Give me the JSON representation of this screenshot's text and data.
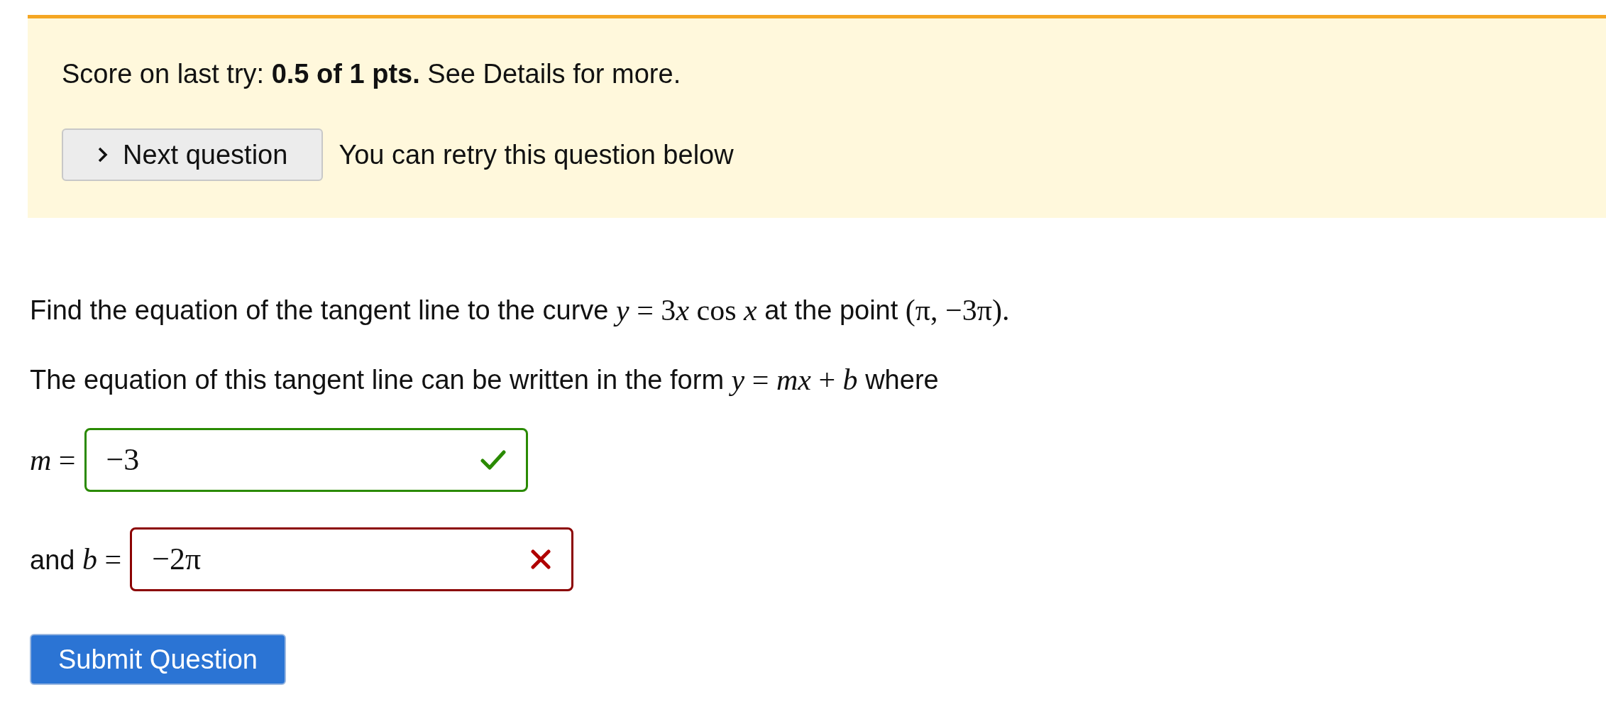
{
  "score_banner": {
    "text": "Score on last try: **0.5 of 1 pts.** See Details for more.",
    "next_button": {
      "label": "Next question"
    },
    "retry_note": "You can retry this question below"
  },
  "question": {
    "paragraphs": [
      [
        {
          "kind": "text",
          "s": "Find the equation of the tangent line to the curve "
        },
        {
          "kind": "math",
          "s": "*y* = 3"
        },
        {
          "kind": "math",
          "s": "*x* cos *x*"
        },
        {
          "kind": "text",
          "s": " at the point "
        },
        {
          "kind": "math",
          "s": "(π, −3π)."
        }
      ],
      [
        {
          "kind": "text",
          "s": "The equation of this tangent line can be written in the form "
        },
        {
          "kind": "math",
          "s": "*y* = *mx* + *b*"
        },
        {
          "kind": "text",
          "s": " where"
        }
      ]
    ],
    "answers": [
      {
        "label": [
          {
            "kind": "math",
            "s": "*m* ="
          }
        ],
        "value": "−3",
        "correct": true
      },
      {
        "label": [
          {
            "kind": "text",
            "s": "and "
          },
          {
            "kind": "math",
            "s": "*b* ="
          }
        ],
        "value": "−2π",
        "correct": false
      }
    ]
  },
  "submit_button": {
    "label": "Submit Question"
  }
}
